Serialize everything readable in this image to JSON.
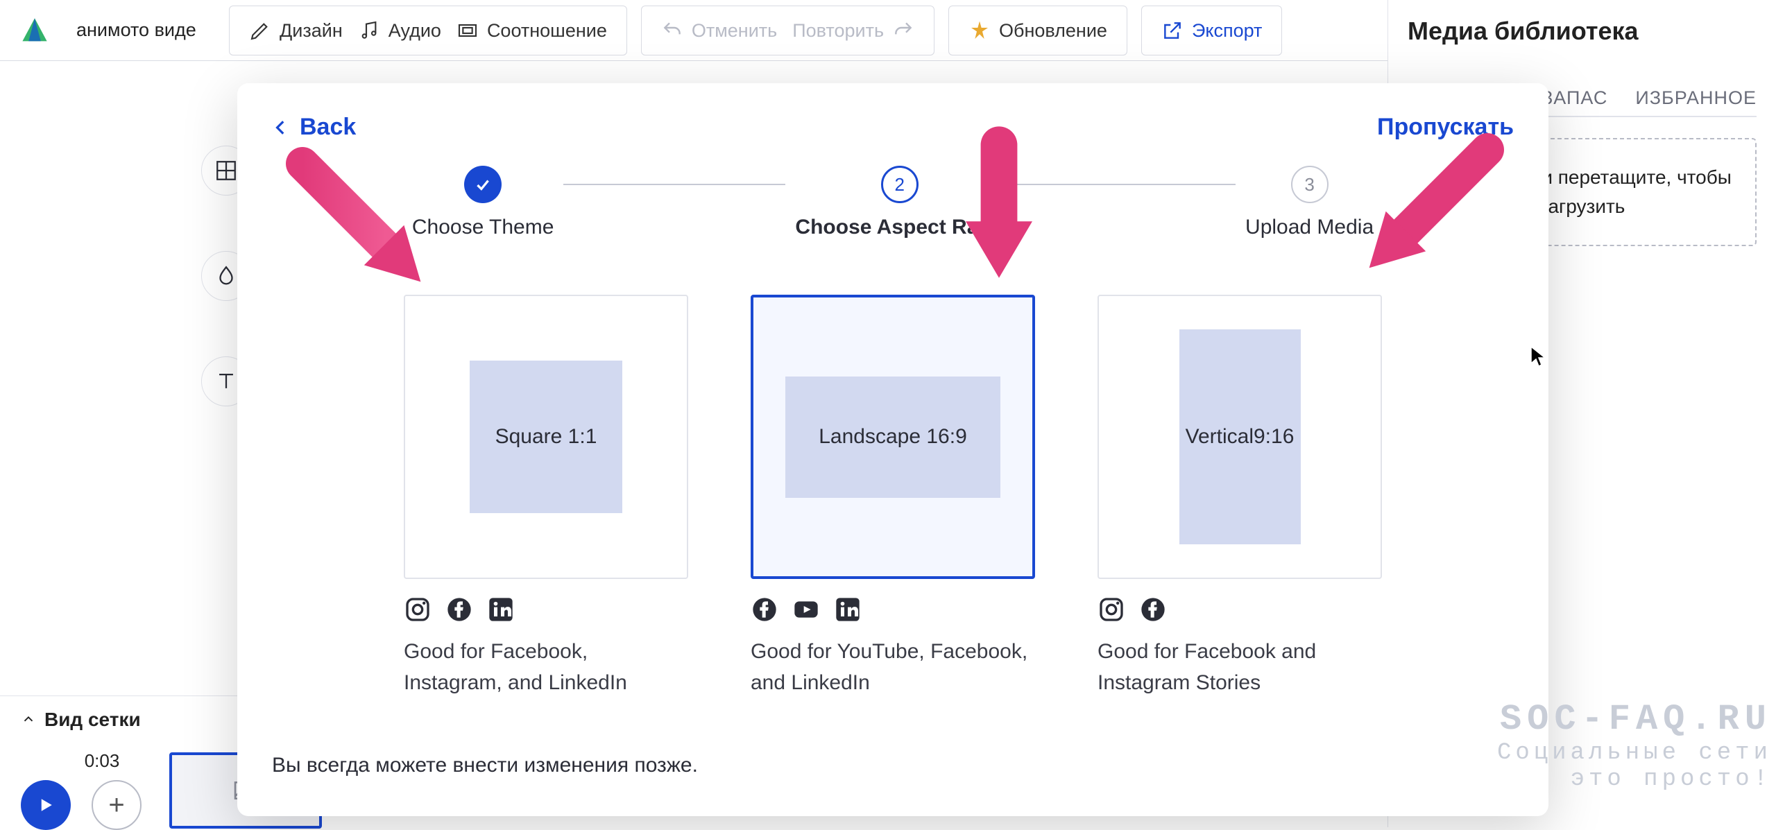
{
  "toolbar": {
    "title_value": "анимото виде",
    "design": "Дизайн",
    "audio": "Аудио",
    "ratio": "Соотношение",
    "undo": "Отменить",
    "redo": "Повторить",
    "update": "Обновление",
    "export": "Экспорт"
  },
  "media_panel": {
    "title": "Медиа библиотека",
    "tab_stock": "ЗАПАС",
    "tab_fav": "ИЗБРАННОЕ",
    "dropzone": "Нажмите или перетащите, чтобы загрузить"
  },
  "bottom": {
    "grid_view": "Вид сетки",
    "timecode": "0:03"
  },
  "modal": {
    "back": "Back",
    "skip": "Пропускать",
    "steps": {
      "s1": "Choose Theme",
      "s2": "Choose Aspect Ratio",
      "s3": "Upload Media",
      "n2": "2",
      "n3": "3"
    },
    "cards": {
      "square": {
        "label": "Square 1:1",
        "desc": "Good for Facebook, Instagram, and LinkedIn"
      },
      "landscape": {
        "label": "Landscape 16:9",
        "desc": "Good for YouTube, Facebook, and LinkedIn"
      },
      "vertical": {
        "label_l1": "Vertical",
        "label_l2": "9:16",
        "desc": "Good for Facebook and Instagram Stories"
      }
    },
    "footnote": "Вы всегда можете внести изменения позже."
  },
  "watermark": {
    "l1": "SOC-FAQ.RU",
    "l2": "Социальные сети",
    "l3": "это просто!"
  }
}
